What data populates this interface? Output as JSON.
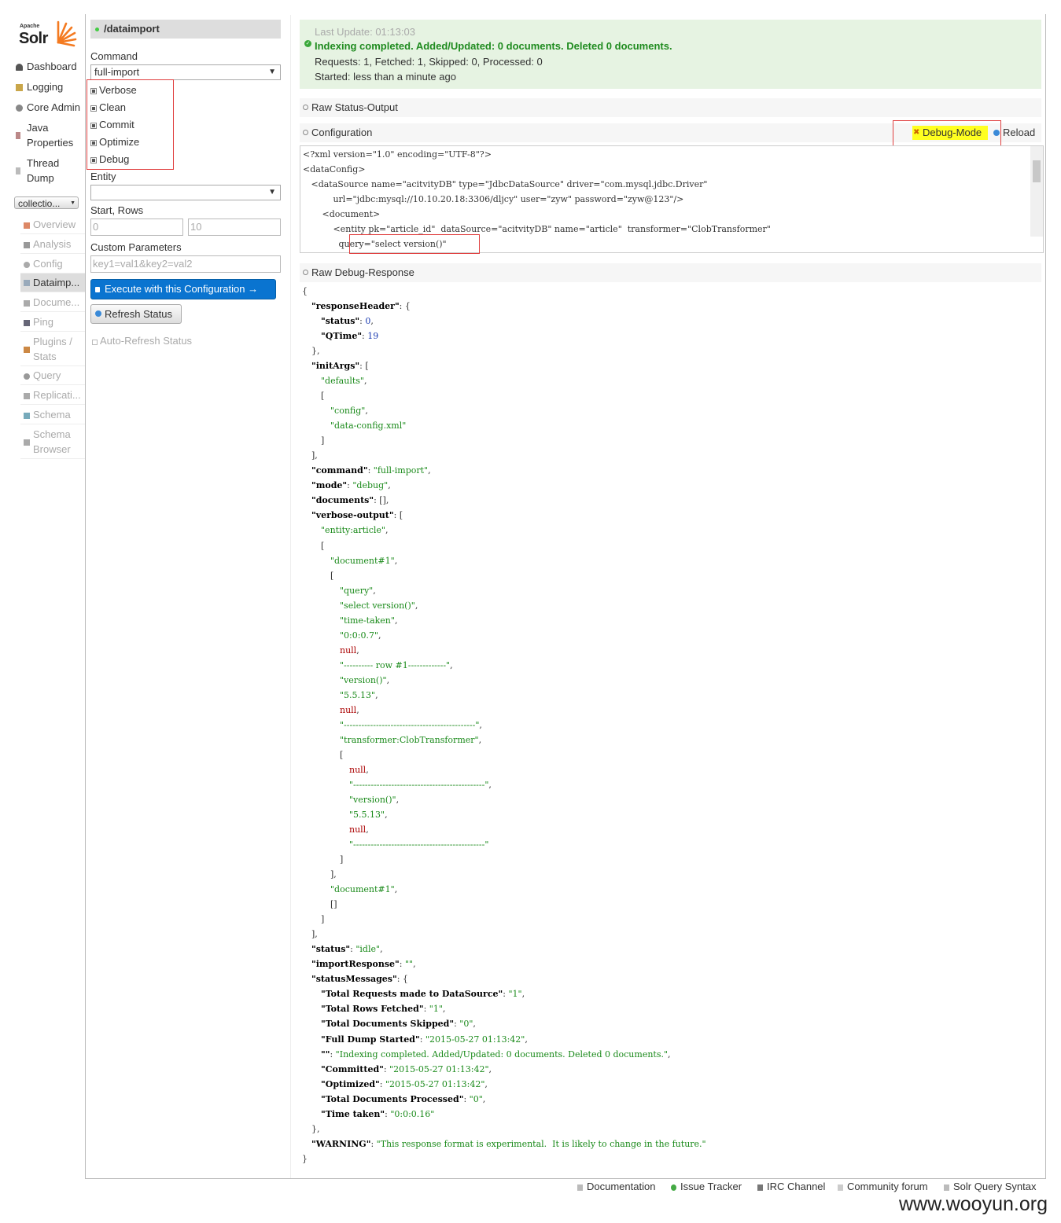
{
  "logo": {
    "apache": "Apache",
    "solr": "Solr"
  },
  "nav": [
    {
      "label": "Dashboard",
      "icon": "dashboard-icon"
    },
    {
      "label": "Logging",
      "icon": "logging-icon"
    },
    {
      "label": "Core Admin",
      "icon": "core-admin-icon"
    },
    {
      "label": "Java Properties",
      "icon": "java-icon"
    },
    {
      "label": "Thread Dump",
      "icon": "thread-dump-icon"
    }
  ],
  "core_selector": {
    "value": "collectio..."
  },
  "core_menu": [
    {
      "label": "Overview"
    },
    {
      "label": "Analysis"
    },
    {
      "label": "Config"
    },
    {
      "label": "Dataimp...",
      "active": true
    },
    {
      "label": "Docume..."
    },
    {
      "label": "Ping"
    },
    {
      "label": "Plugins / Stats"
    },
    {
      "label": "Query"
    },
    {
      "label": "Replicati..."
    },
    {
      "label": "Schema"
    },
    {
      "label": "Schema Browser"
    }
  ],
  "form": {
    "handler": "/dataimport",
    "command_label": "Command",
    "command_value": "full-import",
    "checkboxes": [
      "Verbose",
      "Clean",
      "Commit",
      "Optimize",
      "Debug"
    ],
    "entity_label": "Entity",
    "entity_value": "",
    "start_rows_label": "Start, Rows",
    "start_placeholder": "0",
    "rows_placeholder": "10",
    "custom_params_label": "Custom Parameters",
    "custom_params_placeholder": "key1=val1&key2=val2",
    "execute_label": "Execute with this Configuration →",
    "refresh_label": "Refresh Status",
    "auto_refresh_label": "Auto-Refresh Status"
  },
  "status": {
    "last_update": "Last Update: 01:13:03",
    "headline": "Indexing completed. Added/Updated: 0 documents. Deleted 0 documents.",
    "counts": "Requests: 1, Fetched: 1, Skipped: 0, Processed: 0",
    "started": "Started: less than a minute ago"
  },
  "sections": {
    "raw_status": "Raw Status-Output",
    "configuration": "Configuration",
    "debug_mode": "Debug-Mode",
    "reload": "Reload",
    "raw_debug": "Raw Debug-Response"
  },
  "config_lines": [
    "<?xml version=\"1.0\" encoding=\"UTF-8\"?>",
    "<dataConfig>",
    "   <dataSource name=\"acitvityDB\" type=\"JdbcDataSource\" driver=\"com.mysql.jdbc.Driver\"",
    "           url=\"jdbc:mysql://10.10.20.18:3306/dljcy\" user=\"zyw\" password=\"zyw@123\"/>",
    "       <document>",
    "           <entity pk=\"article_id\"  dataSource=\"acitvityDB\" name=\"article\"  transformer=\"ClobTransformer\"",
    "             query=\"select version()\""
  ],
  "debug_response": [
    {
      "i": 0,
      "p": [
        [
          "{",
          ""
        ]
      ]
    },
    {
      "i": 1,
      "p": [
        [
          "\"responseHeader\"",
          "k"
        ],
        [
          ": {",
          ""
        ]
      ]
    },
    {
      "i": 2,
      "p": [
        [
          "\"status\"",
          "k"
        ],
        [
          ": ",
          ""
        ],
        [
          "0",
          "n"
        ],
        [
          ",",
          ""
        ]
      ]
    },
    {
      "i": 2,
      "p": [
        [
          "\"QTime\"",
          "k"
        ],
        [
          ": ",
          ""
        ],
        [
          "19",
          "n"
        ]
      ]
    },
    {
      "i": 1,
      "p": [
        [
          "},",
          ""
        ]
      ]
    },
    {
      "i": 1,
      "p": [
        [
          "\"initArgs\"",
          "k"
        ],
        [
          ": [",
          ""
        ]
      ]
    },
    {
      "i": 2,
      "p": [
        [
          "\"defaults\"",
          "s"
        ],
        [
          ",",
          ""
        ]
      ]
    },
    {
      "i": 2,
      "p": [
        [
          "[",
          ""
        ]
      ]
    },
    {
      "i": 3,
      "p": [
        [
          "\"config\"",
          "s"
        ],
        [
          ",",
          ""
        ]
      ]
    },
    {
      "i": 3,
      "p": [
        [
          "\"data-config.xml\"",
          "s"
        ]
      ]
    },
    {
      "i": 2,
      "p": [
        [
          "]",
          ""
        ]
      ]
    },
    {
      "i": 1,
      "p": [
        [
          "],",
          ""
        ]
      ]
    },
    {
      "i": 1,
      "p": [
        [
          "\"command\"",
          "k"
        ],
        [
          ": ",
          ""
        ],
        [
          "\"full-import\"",
          "s"
        ],
        [
          ",",
          ""
        ]
      ]
    },
    {
      "i": 1,
      "p": [
        [
          "\"mode\"",
          "k"
        ],
        [
          ": ",
          ""
        ],
        [
          "\"debug\"",
          "s"
        ],
        [
          ",",
          ""
        ]
      ]
    },
    {
      "i": 1,
      "p": [
        [
          "\"documents\"",
          "k"
        ],
        [
          ": [],",
          ""
        ]
      ]
    },
    {
      "i": 1,
      "p": [
        [
          "\"verbose-output\"",
          "k"
        ],
        [
          ": [",
          ""
        ]
      ]
    },
    {
      "i": 2,
      "p": [
        [
          "\"entity:article\"",
          "s"
        ],
        [
          ",",
          ""
        ]
      ]
    },
    {
      "i": 2,
      "p": [
        [
          "[",
          ""
        ]
      ]
    },
    {
      "i": 3,
      "p": [
        [
          "\"document#1\"",
          "s"
        ],
        [
          ",",
          ""
        ]
      ]
    },
    {
      "i": 3,
      "p": [
        [
          "[",
          ""
        ]
      ]
    },
    {
      "i": 4,
      "p": [
        [
          "\"query\"",
          "s"
        ],
        [
          ",",
          ""
        ]
      ]
    },
    {
      "i": 4,
      "p": [
        [
          "\"select version()\"",
          "s"
        ],
        [
          ",",
          ""
        ]
      ]
    },
    {
      "i": 4,
      "p": [
        [
          "\"time-taken\"",
          "s"
        ],
        [
          ",",
          ""
        ]
      ]
    },
    {
      "i": 4,
      "p": [
        [
          "\"0:0:0.7\"",
          "s"
        ],
        [
          ",",
          ""
        ]
      ]
    },
    {
      "i": 4,
      "p": [
        [
          "null",
          "nl"
        ],
        [
          ",",
          ""
        ]
      ]
    },
    {
      "i": 4,
      "p": [
        [
          "\"---------- row #1-------------\"",
          "s"
        ],
        [
          ",",
          ""
        ]
      ]
    },
    {
      "i": 4,
      "p": [
        [
          "\"version()\"",
          "s"
        ],
        [
          ",",
          ""
        ]
      ]
    },
    {
      "i": 4,
      "p": [
        [
          "\"5.5.13\"",
          "s"
        ],
        [
          ",",
          ""
        ]
      ]
    },
    {
      "i": 4,
      "p": [
        [
          "null",
          "nl"
        ],
        [
          ",",
          ""
        ]
      ]
    },
    {
      "i": 4,
      "p": [
        [
          "\"---------------------------------------------\"",
          "s"
        ],
        [
          ",",
          ""
        ]
      ]
    },
    {
      "i": 4,
      "p": [
        [
          "\"transformer:ClobTransformer\"",
          "s"
        ],
        [
          ",",
          ""
        ]
      ]
    },
    {
      "i": 4,
      "p": [
        [
          "[",
          ""
        ]
      ]
    },
    {
      "i": 5,
      "p": [
        [
          "null",
          "nl"
        ],
        [
          ",",
          ""
        ]
      ]
    },
    {
      "i": 5,
      "p": [
        [
          "\"---------------------------------------------\"",
          "s"
        ],
        [
          ",",
          ""
        ]
      ]
    },
    {
      "i": 5,
      "p": [
        [
          "\"version()\"",
          "s"
        ],
        [
          ",",
          ""
        ]
      ]
    },
    {
      "i": 5,
      "p": [
        [
          "\"5.5.13\"",
          "s"
        ],
        [
          ",",
          ""
        ]
      ]
    },
    {
      "i": 5,
      "p": [
        [
          "null",
          "nl"
        ],
        [
          ",",
          ""
        ]
      ]
    },
    {
      "i": 5,
      "p": [
        [
          "\"---------------------------------------------\"",
          "s"
        ]
      ]
    },
    {
      "i": 4,
      "p": [
        [
          "]",
          ""
        ]
      ]
    },
    {
      "i": 3,
      "p": [
        [
          "],",
          ""
        ]
      ]
    },
    {
      "i": 3,
      "p": [
        [
          "\"document#1\"",
          "s"
        ],
        [
          ",",
          ""
        ]
      ]
    },
    {
      "i": 3,
      "p": [
        [
          "[]",
          ""
        ]
      ]
    },
    {
      "i": 2,
      "p": [
        [
          "]",
          ""
        ]
      ]
    },
    {
      "i": 1,
      "p": [
        [
          "],",
          ""
        ]
      ]
    },
    {
      "i": 1,
      "p": [
        [
          "\"status\"",
          "k"
        ],
        [
          ": ",
          ""
        ],
        [
          "\"idle\"",
          "s"
        ],
        [
          ",",
          ""
        ]
      ]
    },
    {
      "i": 1,
      "p": [
        [
          "\"importResponse\"",
          "k"
        ],
        [
          ": ",
          ""
        ],
        [
          "\"\"",
          "s"
        ],
        [
          ",",
          ""
        ]
      ]
    },
    {
      "i": 1,
      "p": [
        [
          "\"statusMessages\"",
          "k"
        ],
        [
          ": {",
          ""
        ]
      ]
    },
    {
      "i": 2,
      "p": [
        [
          "\"Total Requests made to DataSource\"",
          "k"
        ],
        [
          ": ",
          ""
        ],
        [
          "\"1\"",
          "s"
        ],
        [
          ",",
          ""
        ]
      ]
    },
    {
      "i": 2,
      "p": [
        [
          "\"Total Rows Fetched\"",
          "k"
        ],
        [
          ": ",
          ""
        ],
        [
          "\"1\"",
          "s"
        ],
        [
          ",",
          ""
        ]
      ]
    },
    {
      "i": 2,
      "p": [
        [
          "\"Total Documents Skipped\"",
          "k"
        ],
        [
          ": ",
          ""
        ],
        [
          "\"0\"",
          "s"
        ],
        [
          ",",
          ""
        ]
      ]
    },
    {
      "i": 2,
      "p": [
        [
          "\"Full Dump Started\"",
          "k"
        ],
        [
          ": ",
          ""
        ],
        [
          "\"2015-05-27 01:13:42\"",
          "s"
        ],
        [
          ",",
          ""
        ]
      ]
    },
    {
      "i": 2,
      "p": [
        [
          "\"\"",
          "k"
        ],
        [
          ": ",
          ""
        ],
        [
          "\"Indexing completed. Added/Updated: 0 documents. Deleted 0 documents.\"",
          "s"
        ],
        [
          ",",
          ""
        ]
      ]
    },
    {
      "i": 2,
      "p": [
        [
          "\"Committed\"",
          "k"
        ],
        [
          ": ",
          ""
        ],
        [
          "\"2015-05-27 01:13:42\"",
          "s"
        ],
        [
          ",",
          ""
        ]
      ]
    },
    {
      "i": 2,
      "p": [
        [
          "\"Optimized\"",
          "k"
        ],
        [
          ": ",
          ""
        ],
        [
          "\"2015-05-27 01:13:42\"",
          "s"
        ],
        [
          ",",
          ""
        ]
      ]
    },
    {
      "i": 2,
      "p": [
        [
          "\"Total Documents Processed\"",
          "k"
        ],
        [
          ": ",
          ""
        ],
        [
          "\"0\"",
          "s"
        ],
        [
          ",",
          ""
        ]
      ]
    },
    {
      "i": 2,
      "p": [
        [
          "\"Time taken\"",
          "k"
        ],
        [
          ": ",
          ""
        ],
        [
          "\"0:0:0.16\"",
          "s"
        ]
      ]
    },
    {
      "i": 1,
      "p": [
        [
          "},",
          ""
        ]
      ]
    },
    {
      "i": 1,
      "p": [
        [
          "\"WARNING\"",
          "k"
        ],
        [
          ": ",
          ""
        ],
        [
          "\"This response format is experimental.  It is likely to change in the future.\"",
          "s"
        ]
      ]
    },
    {
      "i": 0,
      "p": [
        [
          "}",
          ""
        ]
      ]
    }
  ],
  "footer": [
    "Documentation",
    "Issue Tracker",
    "IRC Channel",
    "Community forum",
    "Solr Query Syntax"
  ],
  "watermark": "www.wooyun.org",
  "colors": {
    "accent": "#0a74d0",
    "success": "#1f8b1f",
    "highlight": "#ffff20",
    "annotation": "#e04040"
  }
}
